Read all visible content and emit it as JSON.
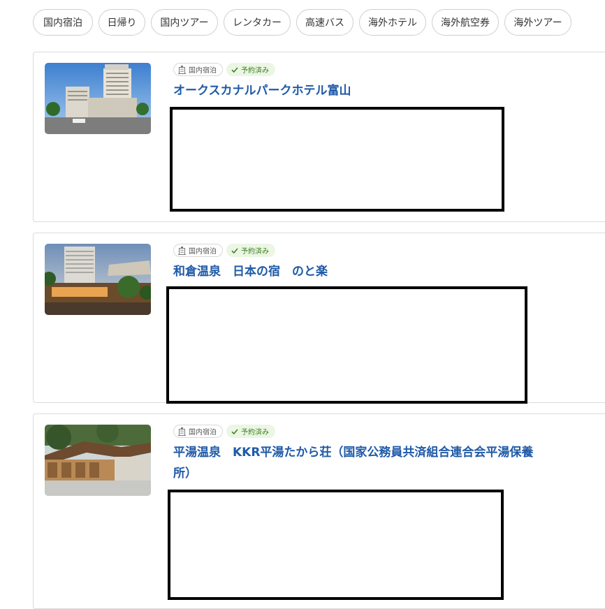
{
  "filter_tabs": [
    {
      "label": "国内宿泊"
    },
    {
      "label": "日帰り"
    },
    {
      "label": "国内ツアー"
    },
    {
      "label": "レンタカー"
    },
    {
      "label": "高速バス"
    },
    {
      "label": "海外ホテル"
    },
    {
      "label": "海外航空券"
    },
    {
      "label": "海外ツアー"
    }
  ],
  "reservations": [
    {
      "category": "国内宿泊",
      "status": "予約済み",
      "name": "オークスカナルパークホテル富山"
    },
    {
      "category": "国内宿泊",
      "status": "予約済み",
      "name": "和倉温泉　日本の宿　のと楽"
    },
    {
      "category": "国内宿泊",
      "status": "予約済み",
      "name": "平湯温泉　KKR平湯たから荘（国家公務員共済組合連合会平湯保養所）"
    }
  ],
  "colors": {
    "title_link": "#1f5aa8",
    "status_badge_bg": "#ebf6e4",
    "status_badge_text": "#3a7d1c"
  },
  "icons": {
    "category": "hotel-building-icon",
    "status": "checkmark-icon"
  }
}
